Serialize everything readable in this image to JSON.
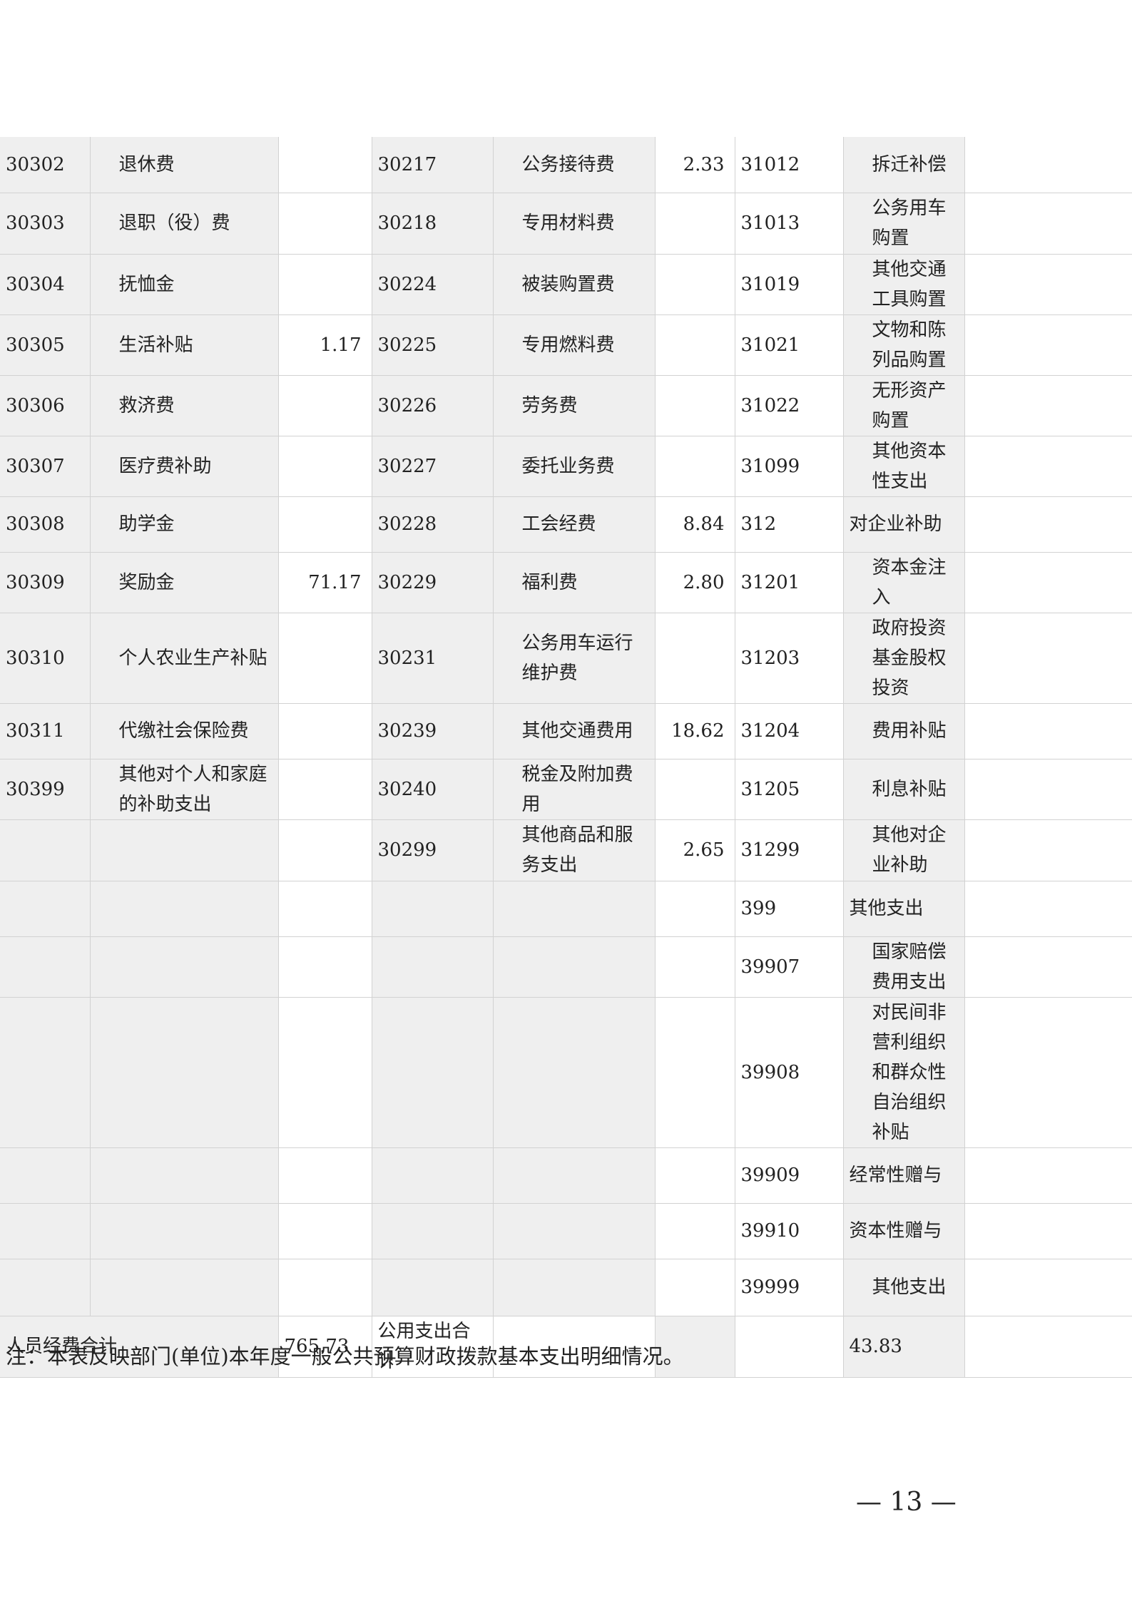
{
  "rows": [
    {
      "h": 78,
      "c1": "30302",
      "n1": "退休费",
      "v1": "",
      "c2": "30217",
      "n2": "公务接待费",
      "v2": "2.33",
      "c3": "31012",
      "n3": "拆迁补偿",
      "v3": "",
      "i1": true,
      "i2": true,
      "i3": true
    },
    {
      "h": 86,
      "c1": "30303",
      "n1": "退职（役）费",
      "v1": "",
      "c2": "30218",
      "n2": "专用材料费",
      "v2": "",
      "c3": "31013",
      "n3": "公务用车购置",
      "v3": "",
      "i1": true,
      "i2": true,
      "i3": true
    },
    {
      "h": 84,
      "c1": "30304",
      "n1": "抚恤金",
      "v1": "",
      "c2": "30224",
      "n2": "被装购置费",
      "v2": "",
      "c3": "31019",
      "n3": "其他交通工具购置",
      "v3": "",
      "i1": true,
      "i2": true,
      "i3": true
    },
    {
      "h": 84,
      "c1": "30305",
      "n1": "生活补贴",
      "v1": "1.17",
      "c2": "30225",
      "n2": "专用燃料费",
      "v2": "",
      "c3": "31021",
      "n3": "文物和陈列品购置",
      "v3": "",
      "i1": true,
      "i2": true,
      "i3": true
    },
    {
      "h": 84,
      "c1": "30306",
      "n1": "救济费",
      "v1": "",
      "c2": "30226",
      "n2": "劳务费",
      "v2": "",
      "c3": "31022",
      "n3": "无形资产购置",
      "v3": "",
      "i1": true,
      "i2": true,
      "i3": true
    },
    {
      "h": 84,
      "c1": "30307",
      "n1": "医疗费补助",
      "v1": "",
      "c2": "30227",
      "n2": "委托业务费",
      "v2": "",
      "c3": "31099",
      "n3": "其他资本性支出",
      "v3": "",
      "i1": true,
      "i2": true,
      "i3": true
    },
    {
      "h": 78,
      "c1": "30308",
      "n1": "助学金",
      "v1": "",
      "c2": "30228",
      "n2": "工会经费",
      "v2": "8.84",
      "c3": "312",
      "n3": "对企业补助",
      "v3": "",
      "i1": true,
      "i2": true,
      "i3": false
    },
    {
      "h": 84,
      "c1": "30309",
      "n1": "奖励金",
      "v1": "71.17",
      "c2": "30229",
      "n2": "福利费",
      "v2": "2.80",
      "c3": "31201",
      "n3": "资本金注入",
      "v3": "",
      "i1": true,
      "i2": true,
      "i3": true
    },
    {
      "h": 126,
      "c1": "30310",
      "n1": "个人农业生产补贴",
      "v1": "",
      "c2": "30231",
      "n2": "公务用车运行维护费",
      "v2": "",
      "c3": "31203",
      "n3": "政府投资基金股权投资",
      "v3": "",
      "i1": true,
      "i2": true,
      "i3": true
    },
    {
      "h": 78,
      "c1": "30311",
      "n1": "代缴社会保险费",
      "v1": "",
      "c2": "30239",
      "n2": "其他交通费用",
      "v2": "18.62",
      "c3": "31204",
      "n3": "费用补贴",
      "v3": "",
      "i1": true,
      "i2": true,
      "i3": true
    },
    {
      "h": 84,
      "c1": "30399",
      "n1": "其他对个人和家庭的补助支出",
      "v1": "",
      "c2": "30240",
      "n2": "税金及附加费用",
      "v2": "",
      "c3": "31205",
      "n3": "利息补贴",
      "v3": "",
      "i1": true,
      "i2": true,
      "i3": true
    },
    {
      "h": 86,
      "c1": "",
      "n1": "",
      "v1": "",
      "c2": "30299",
      "n2": "其他商品和服务支出",
      "v2": "2.65",
      "c3": "31299",
      "n3": "其他对企业补助",
      "v3": "",
      "i1": true,
      "i2": true,
      "i3": true
    },
    {
      "h": 78,
      "c1": "",
      "n1": "",
      "v1": "",
      "c2": "",
      "n2": "",
      "v2": "",
      "c3": "399",
      "n3": "其他支出",
      "v3": "",
      "i1": true,
      "i2": true,
      "i3": false
    },
    {
      "h": 84,
      "c1": "",
      "n1": "",
      "v1": "",
      "c2": "",
      "n2": "",
      "v2": "",
      "c3": "39907",
      "n3": "国家赔偿费用支出",
      "v3": "",
      "i1": true,
      "i2": true,
      "i3": true
    },
    {
      "h": 168,
      "c1": "",
      "n1": "",
      "v1": "",
      "c2": "",
      "n2": "",
      "v2": "",
      "c3": "39908",
      "n3": "对民间非营利组织和群众性自治组织补贴",
      "v3": "",
      "i1": true,
      "i2": true,
      "i3": true
    },
    {
      "h": 78,
      "c1": "",
      "n1": "",
      "v1": "",
      "c2": "",
      "n2": "",
      "v2": "",
      "c3": "39909",
      "n3": "经常性赠与",
      "v3": "",
      "i1": true,
      "i2": true,
      "i3": false
    },
    {
      "h": 78,
      "c1": "",
      "n1": "",
      "v1": "",
      "c2": "",
      "n2": "",
      "v2": "",
      "c3": "39910",
      "n3": "资本性赠与",
      "v3": "",
      "i1": true,
      "i2": true,
      "i3": false
    },
    {
      "h": 80,
      "c1": "",
      "n1": "",
      "v1": "",
      "c2": "",
      "n2": "",
      "v2": "",
      "c3": "39999",
      "n3": "其他支出",
      "v3": "",
      "i1": true,
      "i2": true,
      "i3": true
    }
  ],
  "totals": {
    "personnel_label": "人员经费合计",
    "personnel_value": "765.73",
    "public_label": "公用支出合计",
    "public_value": "43.83"
  },
  "note": "注：本表反映部门(单位)本年度一般公共预算财政拨款基本支出明细情况。",
  "page_number": "— 13 —"
}
